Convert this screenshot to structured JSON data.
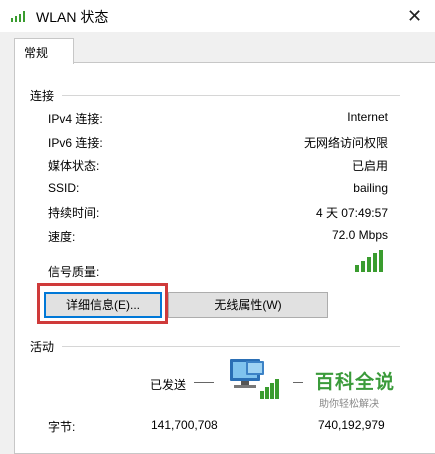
{
  "window": {
    "title": "WLAN 状态",
    "close_glyph": "✕"
  },
  "tab": {
    "label": "常规"
  },
  "connection": {
    "section_label": "连接",
    "rows": [
      {
        "label": "IPv4 连接:",
        "value": "Internet"
      },
      {
        "label": "IPv6 连接:",
        "value": "无网络访问权限"
      },
      {
        "label": "媒体状态:",
        "value": "已启用"
      },
      {
        "label": "SSID:",
        "value": "bailing"
      },
      {
        "label": "持续时间:",
        "value": "4 天 07:49:57"
      },
      {
        "label": "速度:",
        "value": "72.0 Mbps"
      },
      {
        "label": "信号质量:",
        "value": ""
      }
    ],
    "signal_icon": "signal-bars-icon"
  },
  "buttons": {
    "details": "详细信息(E)...",
    "wireless": "无线属性(W)"
  },
  "activity": {
    "section_label": "活动",
    "sent_label": "已发送",
    "bytes_label": "字节:",
    "bytes_sent": "141,700,708",
    "bytes_received": "740,192,979",
    "network_icon": "network-computer-icon"
  },
  "watermark": {
    "main": "百科全说",
    "sub": "助你轻松解决"
  },
  "colors": {
    "focus_outline": "#cf3a3a",
    "signal_green": "#3a9c2f",
    "accent_blue": "#0078d7"
  }
}
